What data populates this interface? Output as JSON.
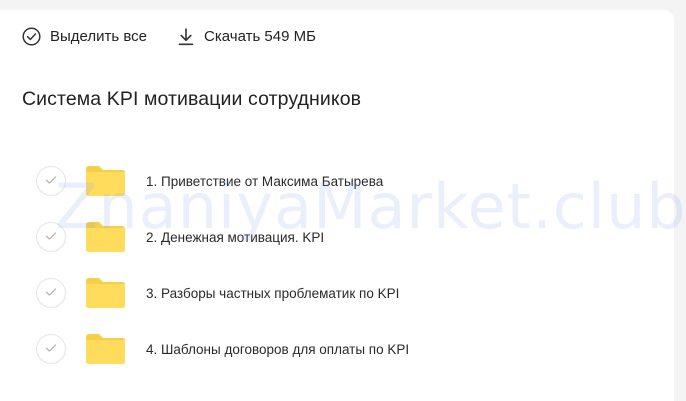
{
  "toolbar": {
    "select_all_label": "Выделить все",
    "download_label": "Скачать 549 МБ"
  },
  "folder": {
    "title": "Система KPI мотивации сотрудников",
    "items": [
      {
        "label": "1. Приветствие от Максима Батырева"
      },
      {
        "label": "2. Денежная мотивация. KPI"
      },
      {
        "label": "3. Разборы частных проблематик по KPI"
      },
      {
        "label": "4. Шаблоны договоров для оплаты по KPI"
      }
    ]
  },
  "watermark": "ZnaniyaMarket.club",
  "colors": {
    "folder_yellow": "#ffdc5c",
    "folder_yellow_dark": "#f5cf4a",
    "check_gray": "#b8b8bc"
  },
  "icons": {
    "select_all": "circle-check-icon",
    "download": "download-arrow-icon",
    "item_check": "check-icon",
    "item_folder": "folder-icon"
  }
}
